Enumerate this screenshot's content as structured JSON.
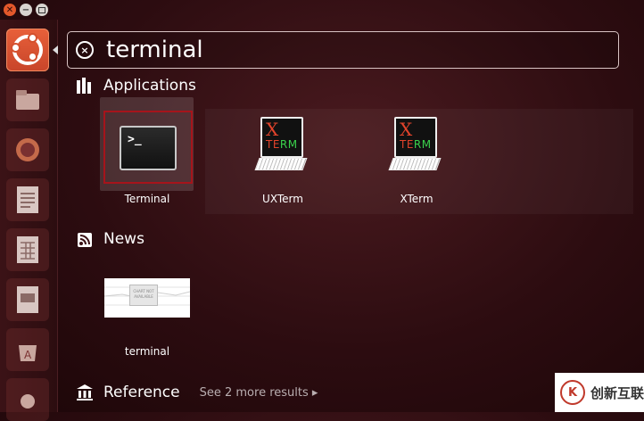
{
  "search": {
    "query": "terminal"
  },
  "sections": {
    "applications": {
      "title": "Applications"
    },
    "news": {
      "title": "News"
    },
    "reference": {
      "title": "Reference",
      "more": "See 2 more results"
    }
  },
  "applications": [
    {
      "label": "Terminal",
      "icon": "terminal-icon",
      "selected": true
    },
    {
      "label": "UXTerm",
      "icon": "xterm-icon"
    },
    {
      "label": "XTerm",
      "icon": "xterm-icon"
    }
  ],
  "news": [
    {
      "label": "terminal",
      "thumb_text": "CHART NOT AVAILABLE"
    }
  ],
  "xterm_icon_text": {
    "x": "X",
    "term": "TERM"
  },
  "terminal_prompt": ">_",
  "watermark": {
    "text": "创新互联",
    "logo": "K"
  },
  "colors": {
    "accent": "#e8603a",
    "selection_border": "#a6141b"
  }
}
